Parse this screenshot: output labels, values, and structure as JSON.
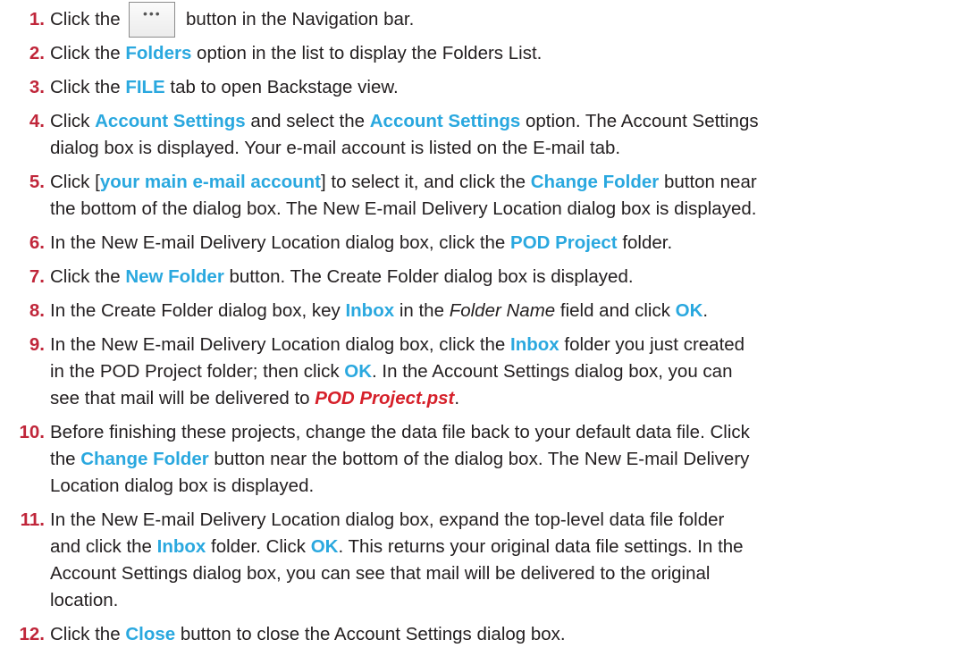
{
  "steps": [
    {
      "num": "1.",
      "parts": [
        {
          "t": "Click the "
        },
        {
          "btn": "more-button",
          "icon": "more-horizontal-icon"
        },
        {
          "t": " button in the Navigation bar."
        }
      ]
    },
    {
      "num": "2.",
      "parts": [
        {
          "t": "Click the "
        },
        {
          "t": "Folders",
          "s": "hl"
        },
        {
          "t": " option in the list to display the Folders List."
        }
      ]
    },
    {
      "num": "3.",
      "parts": [
        {
          "t": "Click the "
        },
        {
          "t": "FILE",
          "s": "hl"
        },
        {
          "t": " tab to open Backstage view."
        }
      ]
    },
    {
      "num": "4.",
      "parts": [
        {
          "t": "Click "
        },
        {
          "t": "Account Settings",
          "s": "hl"
        },
        {
          "t": " and select the "
        },
        {
          "t": "Account Settings",
          "s": "hl"
        },
        {
          "t": " option. The Account Settings"
        },
        {
          "br": true
        },
        {
          "t": "dialog box is displayed. Your e-mail account is listed on the E-mail tab."
        }
      ]
    },
    {
      "num": "5.",
      "parts": [
        {
          "t": "Click ["
        },
        {
          "t": "your main e-mail account",
          "s": "hl"
        },
        {
          "t": "] to select it, and click the "
        },
        {
          "t": "Change Folder",
          "s": "hl"
        },
        {
          "t": " button near"
        },
        {
          "br": true
        },
        {
          "t": "the bottom of the dialog box. The New E-mail Delivery Location dialog box is displayed."
        }
      ]
    },
    {
      "num": "6.",
      "parts": [
        {
          "t": "In the New E-mail Delivery Location dialog box, click the "
        },
        {
          "t": "POD Project",
          "s": "hl"
        },
        {
          "t": " folder."
        }
      ]
    },
    {
      "num": "7.",
      "parts": [
        {
          "t": "Click the "
        },
        {
          "t": "New Folder",
          "s": "hl"
        },
        {
          "t": " button. The Create Folder dialog box is displayed."
        }
      ]
    },
    {
      "num": "8.",
      "parts": [
        {
          "t": "In the Create Folder dialog box, key "
        },
        {
          "t": "Inbox",
          "s": "hl"
        },
        {
          "t": " in the "
        },
        {
          "t": "Folder Name",
          "s": "it"
        },
        {
          "t": " field and click "
        },
        {
          "t": "OK",
          "s": "hl"
        },
        {
          "t": "."
        }
      ]
    },
    {
      "num": "9.",
      "parts": [
        {
          "t": "In the New E-mail Delivery Location dialog box, click the "
        },
        {
          "t": "Inbox",
          "s": "hl"
        },
        {
          "t": " folder you just created"
        },
        {
          "br": true
        },
        {
          "t": "in the POD Project folder; then click "
        },
        {
          "t": "OK",
          "s": "hl"
        },
        {
          "t": ". In the Account Settings dialog box, you can"
        },
        {
          "br": true
        },
        {
          "t": "see that mail will be delivered to "
        },
        {
          "t": "POD Project.pst",
          "s": "red-italic"
        },
        {
          "t": "."
        }
      ]
    },
    {
      "num": "10.",
      "parts": [
        {
          "t": "Before finishing these projects, change the data file back to your default data file. Click"
        },
        {
          "br": true
        },
        {
          "t": "the "
        },
        {
          "t": "Change Folder",
          "s": "hl"
        },
        {
          "t": " button near the bottom of the dialog box. The New E-mail Delivery"
        },
        {
          "br": true
        },
        {
          "t": "Location dialog box is displayed."
        }
      ]
    },
    {
      "num": "11.",
      "parts": [
        {
          "t": "In the New E-mail Delivery Location dialog box, expand the top-level data file folder"
        },
        {
          "br": true
        },
        {
          "t": "and click the "
        },
        {
          "t": "Inbox",
          "s": "hl"
        },
        {
          "t": " folder. Click "
        },
        {
          "t": "OK",
          "s": "hl"
        },
        {
          "t": ". This returns your original data file settings. In the"
        },
        {
          "br": true
        },
        {
          "t": "Account Settings dialog box, you can see that mail will be delivered to the original"
        },
        {
          "br": true
        },
        {
          "t": "location."
        }
      ]
    },
    {
      "num": "12.",
      "parts": [
        {
          "t": "Click the "
        },
        {
          "t": "Close",
          "s": "hl"
        },
        {
          "t": " button to close the Account Settings dialog box."
        }
      ]
    }
  ]
}
